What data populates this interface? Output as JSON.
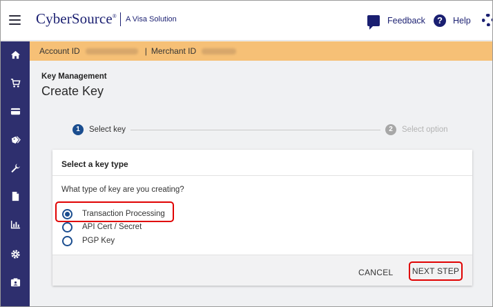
{
  "header": {
    "logo": "CyberSource",
    "logo_reg": "®",
    "logo_sub": "A Visa Solution",
    "feedback_label": "Feedback",
    "help_label": "Help",
    "help_glyph": "?"
  },
  "sidebar": {
    "items": [
      {
        "icon": "home-icon"
      },
      {
        "icon": "cart-icon"
      },
      {
        "icon": "credit-card-icon"
      },
      {
        "icon": "tags-icon"
      },
      {
        "icon": "wrench-icon"
      },
      {
        "icon": "document-icon"
      },
      {
        "icon": "bar-chart-icon"
      },
      {
        "icon": "gear-icon"
      },
      {
        "icon": "id-card-icon"
      }
    ]
  },
  "account_bar": {
    "account_label": "Account ID",
    "separator": "|",
    "merchant_label": "Merchant ID"
  },
  "page": {
    "breadcrumb": "Key Management",
    "title": "Create Key"
  },
  "stepper": {
    "steps": [
      {
        "number": "1",
        "label": "Select key"
      },
      {
        "number": "2",
        "label": "Select option"
      }
    ]
  },
  "card": {
    "title": "Select a key type",
    "question": "What type of key are you creating?",
    "options": [
      {
        "label": "Transaction Processing",
        "selected": true
      },
      {
        "label": "API Cert / Secret",
        "selected": false
      },
      {
        "label": "PGP Key",
        "selected": false
      }
    ],
    "cancel_label": "CANCEL",
    "next_label": "NEXT STEP"
  },
  "colors": {
    "brand": "#1a1f71",
    "sidebar": "#2e2f6e",
    "account_bar": "#f6c076",
    "highlight": "#e00000"
  }
}
